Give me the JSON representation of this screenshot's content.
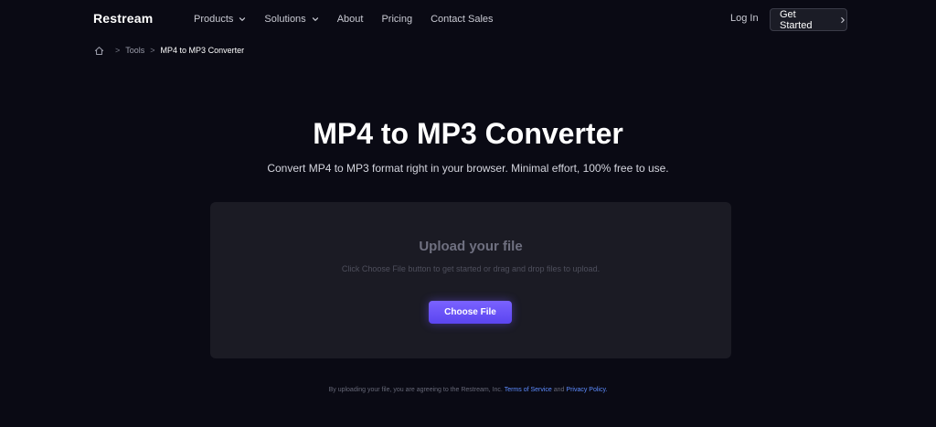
{
  "header": {
    "logo": "Restream",
    "nav": {
      "products": "Products",
      "solutions": "Solutions",
      "about": "About",
      "pricing": "Pricing",
      "contact_sales": "Contact Sales"
    },
    "login": "Log In",
    "get_started": "Get Started"
  },
  "breadcrumb": {
    "separator": ">",
    "tools": "Tools",
    "current": "MP4 to MP3 Converter"
  },
  "hero": {
    "title": "MP4 to MP3 Converter",
    "subtitle": "Convert MP4 to MP3 format right in your browser. Minimal effort, 100% free to use."
  },
  "upload": {
    "title": "Upload your file",
    "description": "Click Choose File button to get started or drag and drop files to upload.",
    "button": "Choose File"
  },
  "footer": {
    "prefix": "By uploading your file, you are agreeing to the Restream, Inc.",
    "terms": "Terms of Service",
    "and": "and",
    "privacy": "Privacy Policy."
  },
  "icons": {
    "home": "home-icon",
    "nav_chevron": "chevron-down-icon",
    "button_arrow": "chevron-right-icon"
  },
  "colors": {
    "background": "#0a0a14",
    "panel": "#1b1b24",
    "accent": "#6a52ff",
    "link": "#5d8cff"
  }
}
